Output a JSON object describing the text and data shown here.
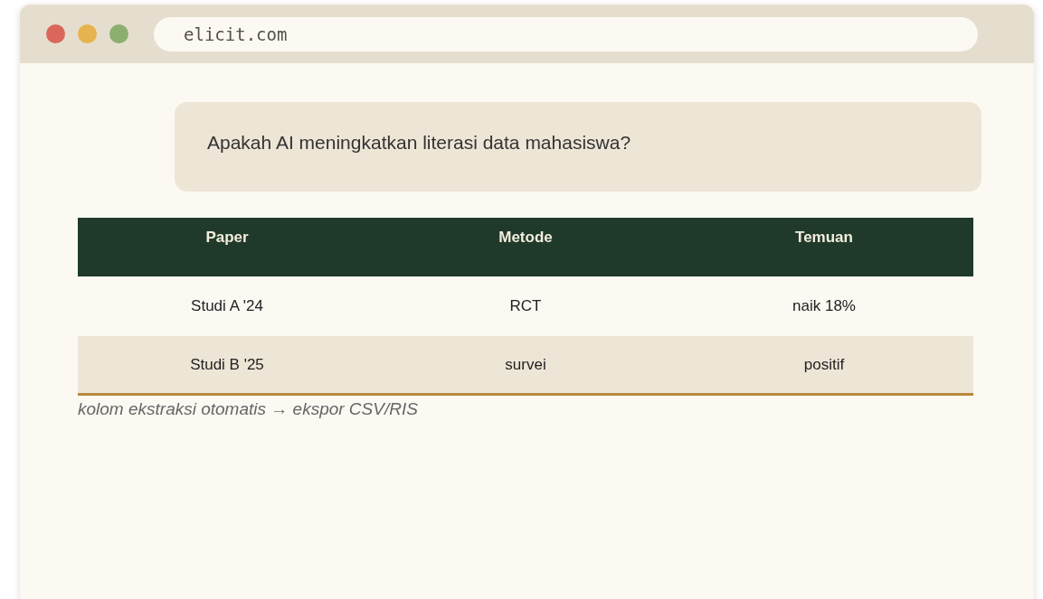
{
  "browser": {
    "url": "elicit.com"
  },
  "query": {
    "text": "Apakah AI meningkatkan literasi data mahasiswa?"
  },
  "table": {
    "columns": [
      "Paper",
      "Metode",
      "Temuan"
    ],
    "rows": [
      {
        "cells": [
          "Studi A '24",
          "RCT",
          "naik 18%"
        ]
      },
      {
        "cells": [
          "Studi B '25",
          "survei",
          "positif"
        ]
      }
    ]
  },
  "caption": "kolom ekstraksi otomatis → ekspor CSV/RIS"
}
